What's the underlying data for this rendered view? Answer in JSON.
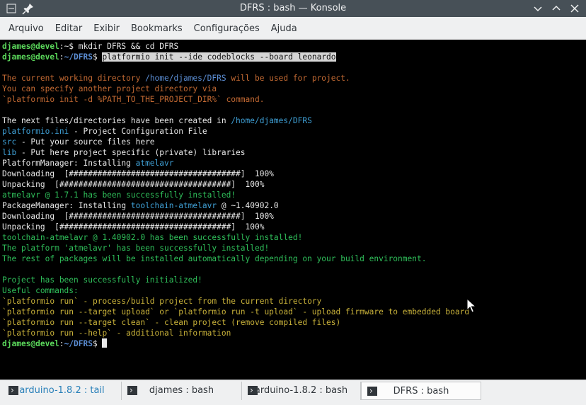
{
  "window": {
    "title": "DFRS : bash — Konsole"
  },
  "titlebar": {
    "left_icons": [
      "minimize-icon",
      "pin-icon"
    ],
    "right_icons": [
      "chevron-down-icon",
      "restore-icon",
      "close-icon"
    ]
  },
  "menu": [
    "Arquivo",
    "Editar",
    "Exibir",
    "Bookmarks",
    "Configurações",
    "Ajuda"
  ],
  "terminal_lines": [
    [
      {
        "t": "djames@devel",
        "c": "lg"
      },
      {
        "t": ":~$ mkdir DFRS && cd DFRS",
        "c": "def"
      }
    ],
    [
      {
        "t": "djames@devel",
        "c": "lg"
      },
      {
        "t": ":",
        "c": "def"
      },
      {
        "t": "~/DFRS",
        "c": "blue"
      },
      {
        "t": "$ ",
        "c": "def"
      },
      {
        "t": "platformio init --ide codeblocks --board leonardo",
        "c": "sel"
      }
    ],
    [],
    [
      {
        "t": "The current working directory ",
        "c": "or"
      },
      {
        "t": "/home/djames/DFRS",
        "c": "orb"
      },
      {
        "t": " will be used for project.",
        "c": "or"
      }
    ],
    [
      {
        "t": "You can specify another project directory via",
        "c": "or"
      }
    ],
    [
      {
        "t": "`platformio init -d %PATH_TO_THE_PROJECT_DIR%` command.",
        "c": "or"
      }
    ],
    [],
    [
      {
        "t": "The next files/directories have been created in ",
        "c": "def"
      },
      {
        "t": "/home/djames/DFRS",
        "c": "cy"
      }
    ],
    [
      {
        "t": "platformio.ini",
        "c": "cy"
      },
      {
        "t": " - Project Configuration File",
        "c": "def"
      }
    ],
    [
      {
        "t": "src",
        "c": "cy"
      },
      {
        "t": " - Put your source files here",
        "c": "def"
      }
    ],
    [
      {
        "t": "lib",
        "c": "cy"
      },
      {
        "t": " - Put here project specific (private) libraries",
        "c": "def"
      }
    ],
    [
      {
        "t": "PlatformManager: Installing ",
        "c": "def"
      },
      {
        "t": "atmelavr",
        "c": "cy"
      }
    ],
    [
      {
        "t": "Downloading  [####################################]  100%",
        "c": "def"
      }
    ],
    [
      {
        "t": "Unpacking  [####################################]  100%",
        "c": "def"
      }
    ],
    [
      {
        "t": "atmelavr @ 1.7.1 has been successfully installed!",
        "c": "grn"
      }
    ],
    [
      {
        "t": "PackageManager: Installing ",
        "c": "def"
      },
      {
        "t": "toolchain-atmelavr",
        "c": "cy"
      },
      {
        "t": " @ ~1.40902.0",
        "c": "def"
      }
    ],
    [
      {
        "t": "Downloading  [####################################]  100%",
        "c": "def"
      }
    ],
    [
      {
        "t": "Unpacking  [####################################]  100%",
        "c": "def"
      }
    ],
    [
      {
        "t": "toolchain-atmelavr @ 1.40902.0 has been successfully installed!",
        "c": "grn"
      }
    ],
    [
      {
        "t": "The platform 'atmelavr' has been successfully installed!",
        "c": "grn"
      }
    ],
    [
      {
        "t": "The rest of packages will be installed automatically depending on your build environment.",
        "c": "grn"
      }
    ],
    [],
    [
      {
        "t": "Project has been successfully initialized!",
        "c": "grn"
      }
    ],
    [
      {
        "t": "Useful commands:",
        "c": "grn"
      }
    ],
    [
      {
        "t": "`platformio run` - process/build project from the current directory",
        "c": "yel"
      }
    ],
    [
      {
        "t": "`platformio run --target upload` or `platformio run -t upload` - upload firmware to embedded board",
        "c": "yel"
      }
    ],
    [
      {
        "t": "`platformio run --target clean` - clean project (remove compiled files)",
        "c": "yel"
      }
    ],
    [
      {
        "t": "`platformio run --help` - additional information",
        "c": "yel"
      }
    ],
    [
      {
        "t": "djames@devel",
        "c": "lg"
      },
      {
        "t": ":",
        "c": "def"
      },
      {
        "t": "~/DFRS",
        "c": "blue"
      },
      {
        "t": "$ ",
        "c": "def"
      },
      {
        "t": "",
        "c": "cursor"
      }
    ]
  ],
  "tabs": [
    {
      "label": "arduino-1.8.2 : tail",
      "state": "blue"
    },
    {
      "label": "djames : bash",
      "state": "normal"
    },
    {
      "label": "arduino-1.8.2 : bash",
      "state": "normal"
    },
    {
      "label": "DFRS : bash",
      "state": "active"
    }
  ]
}
